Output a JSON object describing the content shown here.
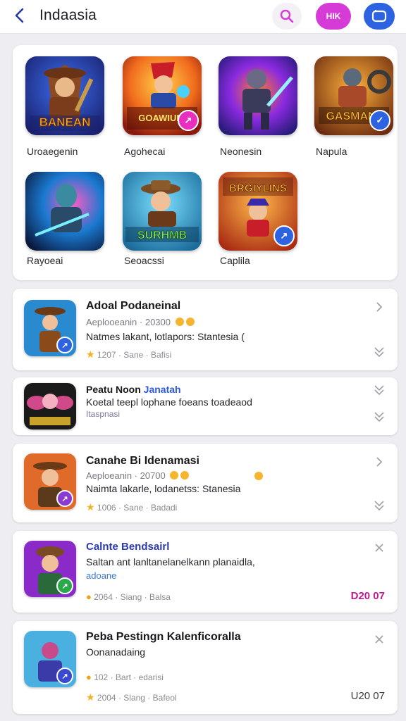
{
  "header": {
    "title": "Indaasia",
    "pill_label": "HIK",
    "colors": {
      "search": "#d63bd8",
      "pill": "#d63bd8",
      "view": "#2d63e0"
    }
  },
  "grid": {
    "items": [
      {
        "label": "Uroaegenin",
        "art_text": "BANEAN",
        "icon": "cowboy-warrior-art"
      },
      {
        "label": "Agohecai",
        "art_text": "GOAWIUD",
        "icon": "red-hat-hero-art"
      },
      {
        "label": "Neonesin",
        "art_text": "",
        "icon": "neon-knight-art"
      },
      {
        "label": "Napula",
        "art_text": "GASMAN",
        "icon": "robot-brawler-art"
      },
      {
        "label": "Rayoeai",
        "art_text": "",
        "icon": "blue-alien-art"
      },
      {
        "label": "Seoacssi",
        "art_text": "SURHMB",
        "icon": "explorer-hat-art"
      },
      {
        "label": "Caplila",
        "art_text": "BRGIYLINS",
        "icon": "pirate-kid-art"
      }
    ]
  },
  "list": [
    {
      "title": "Adoal Podaneinal",
      "sub": "Aeplooeanin · 20300",
      "desc": "Natmes lakant, lotlapors: Stantesia (",
      "meta_rating": "1207",
      "meta_text": "Sane · Bafisi",
      "price": "",
      "icon": "female-adventurer-art"
    },
    {
      "title": "Peatu Noon",
      "title_highlight": "Janatah",
      "sub": "",
      "desc": "Koetal teepl lophane foeans toadeaod",
      "meta_rating": "",
      "meta_text": "Itaspnasi",
      "price": "",
      "icon": "winged-fairy-art"
    },
    {
      "title": "Canahe Bi Idenamasi",
      "sub": "Aeploeanin · 20700",
      "desc": "Naimta lakarle, lodanetss: Stanesia",
      "meta_rating": "1006",
      "meta_text": "Sane · Badadi",
      "price": "",
      "icon": "hat-explorer-art"
    },
    {
      "title": "Calnte Bendsairl",
      "sub": "",
      "desc": "Saltan ant lanltanelanelkann planaidla,",
      "link": "adoane",
      "meta_rating": "2064",
      "meta_text": "Siang · Balsa",
      "price": "D20 07",
      "price_color": "#c2188f",
      "icon": "young-hero-art"
    },
    {
      "title": "Peba Pestingn Kalenficoralla",
      "sub": "Oonanadaing",
      "desc": "",
      "meta_rating": "102",
      "meta_text": "Bart · edarisi",
      "meta2_rating": "2004",
      "meta2_text": "Slang · Bafeol",
      "price": "U20 07",
      "price_color": "#3a3a44",
      "icon": "masked-rider-art"
    }
  ]
}
